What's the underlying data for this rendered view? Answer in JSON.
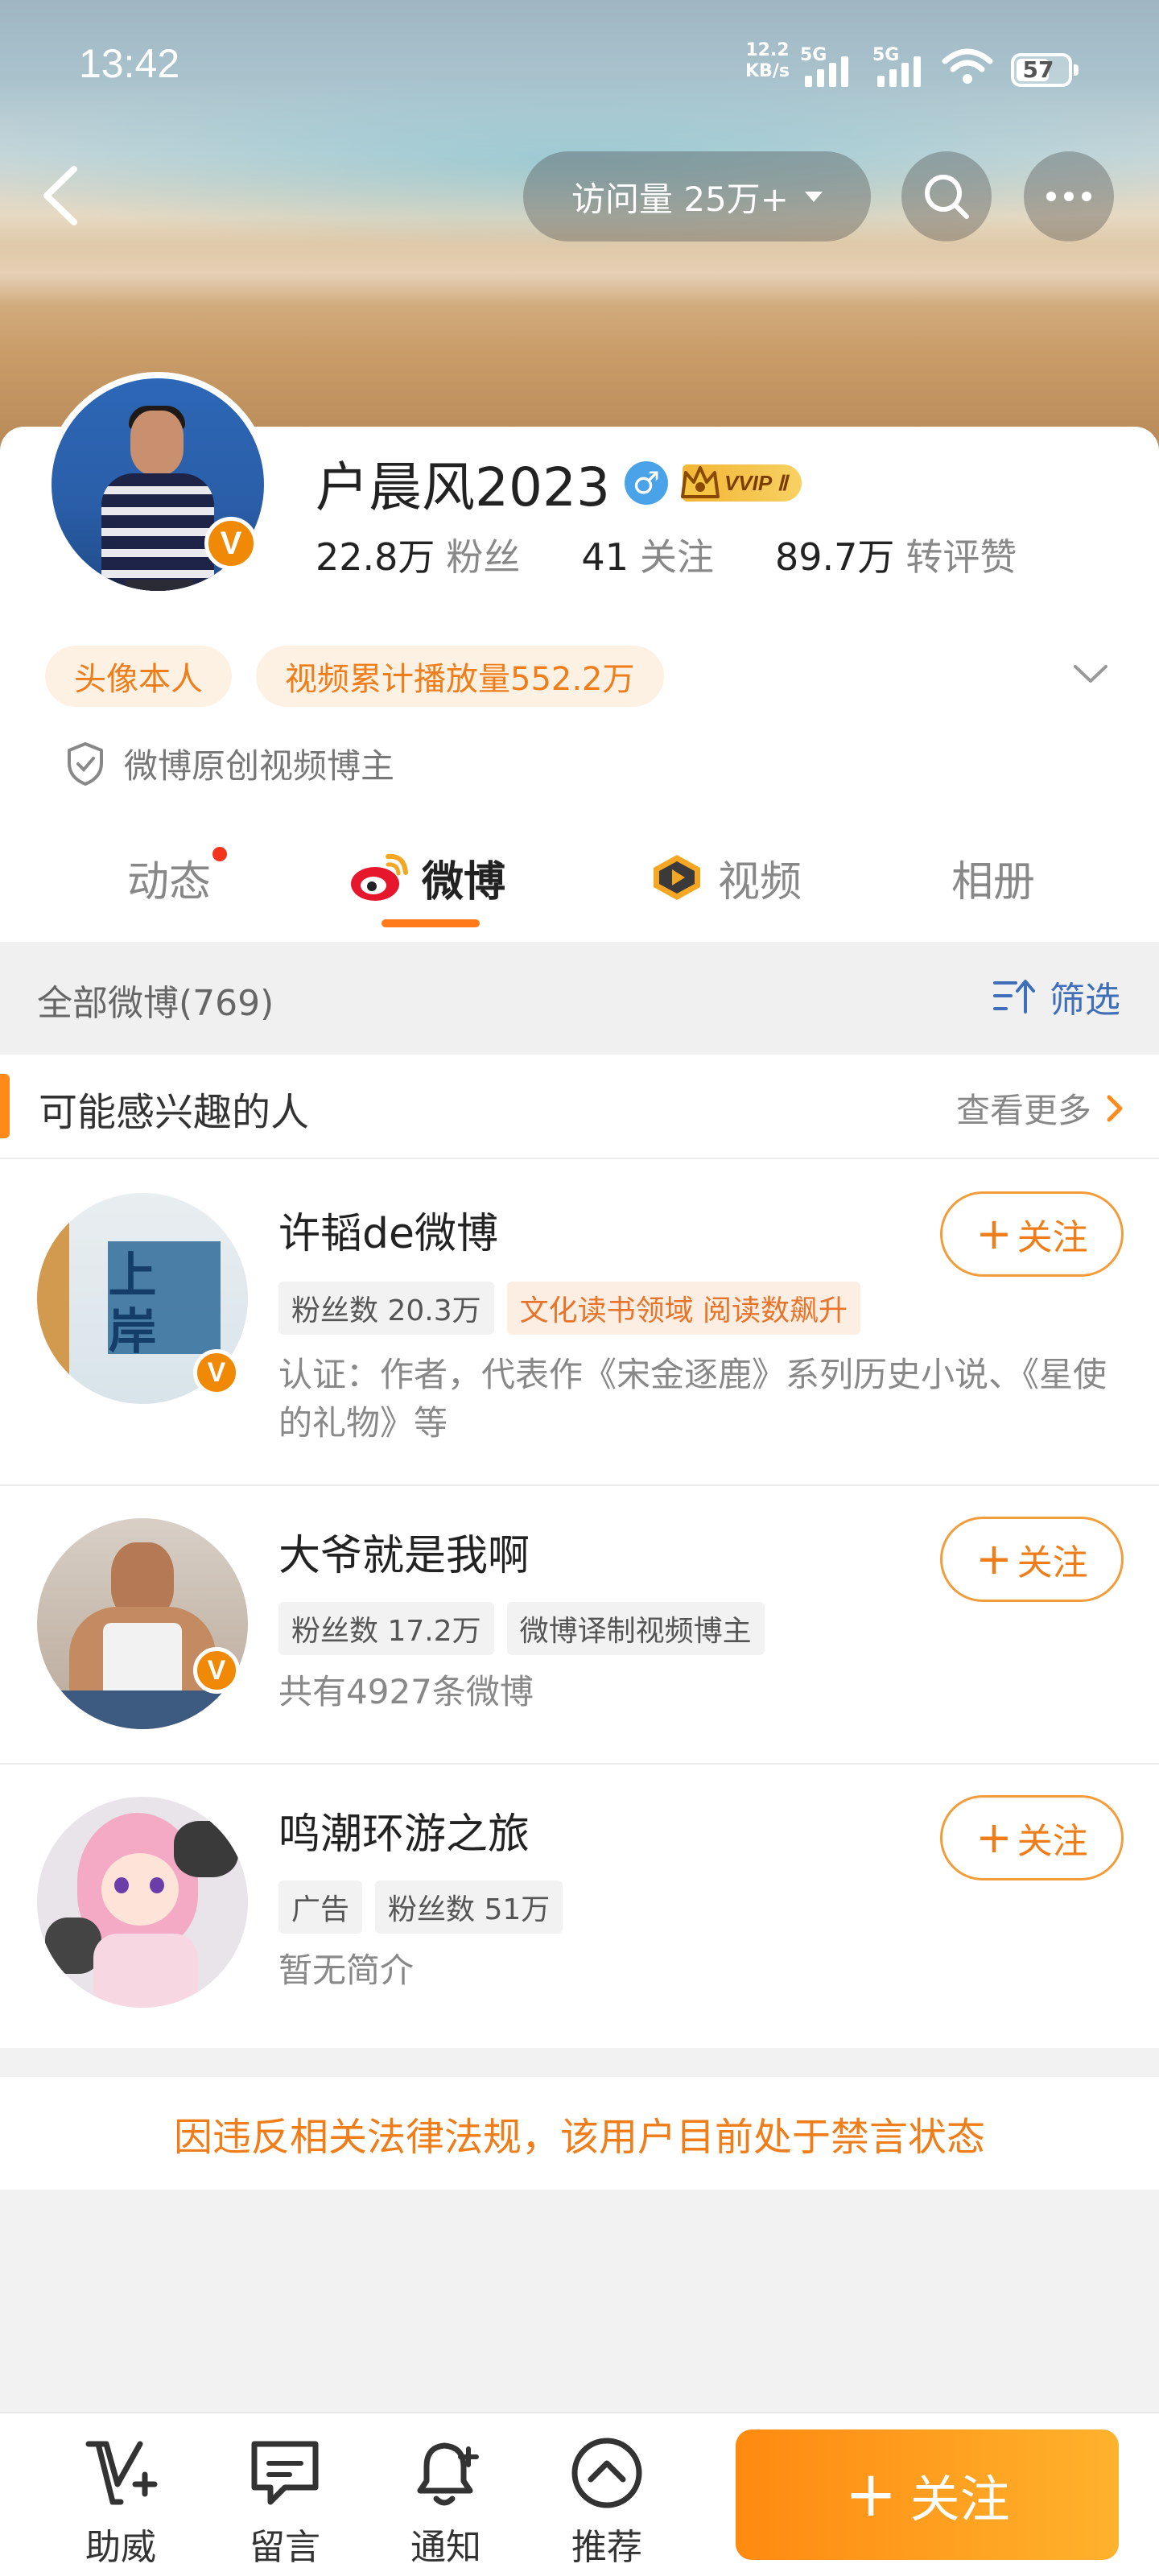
{
  "status_bar": {
    "time": "13:42",
    "net_speed": "12.2",
    "net_unit": "KB/s",
    "sim1_label": "5G",
    "sim2_label": "5G",
    "battery": "57"
  },
  "top_nav": {
    "visits_label": "访问量 25万+"
  },
  "profile": {
    "name": "户晨风2023",
    "gender_symbol": "♂",
    "vip_label": "VVIP Ⅱ",
    "fans_count": "22.8万",
    "fans_label": "粉丝",
    "following_count": "41",
    "following_label": "关注",
    "engagement_count": "89.7万",
    "engagement_label": "转评赞",
    "tags": [
      "头像本人",
      "视频累计播放量552.2万"
    ],
    "verification": "微博原创视频博主"
  },
  "tabs": [
    {
      "label": "动态"
    },
    {
      "label": "微博"
    },
    {
      "label": "视频"
    },
    {
      "label": "相册"
    }
  ],
  "feed": {
    "count_label": "全部微博(769)",
    "filter_label": "筛选"
  },
  "suggestions": {
    "title": "可能感兴趣的人",
    "more_label": "查看更多",
    "follow_label": "关注",
    "people": [
      {
        "name": "许韬de微博",
        "tags": [
          "粉丝数 20.3万",
          "文化读书领域 阅读数飙升"
        ],
        "desc": "认证：作者，代表作《宋金逐鹿》系列历史小说、《星使的礼物》等",
        "avatar_text": "上岸"
      },
      {
        "name": "大爷就是我啊",
        "tags": [
          "粉丝数 17.2万",
          "微博译制视频博主"
        ],
        "desc": "共有4927条微博"
      },
      {
        "name": "鸣潮环游之旅",
        "tags": [
          "广告",
          "粉丝数 51万"
        ],
        "desc": "暂无简介"
      }
    ]
  },
  "notice": "因违反相关法律法规，该用户目前处于禁言状态",
  "bottom_bar": {
    "items": [
      {
        "label": "助威",
        "icon": "cheer-icon"
      },
      {
        "label": "留言",
        "icon": "message-icon"
      },
      {
        "label": "通知",
        "icon": "bell-plus-icon"
      },
      {
        "label": "推荐",
        "icon": "recommend-icon"
      }
    ],
    "follow_label": "关注"
  },
  "colors": {
    "accent": "#ff8a10",
    "verify_badge": "#f08a06",
    "tag_text": "#ee7d1a",
    "link_blue": "#3e6fb8"
  }
}
